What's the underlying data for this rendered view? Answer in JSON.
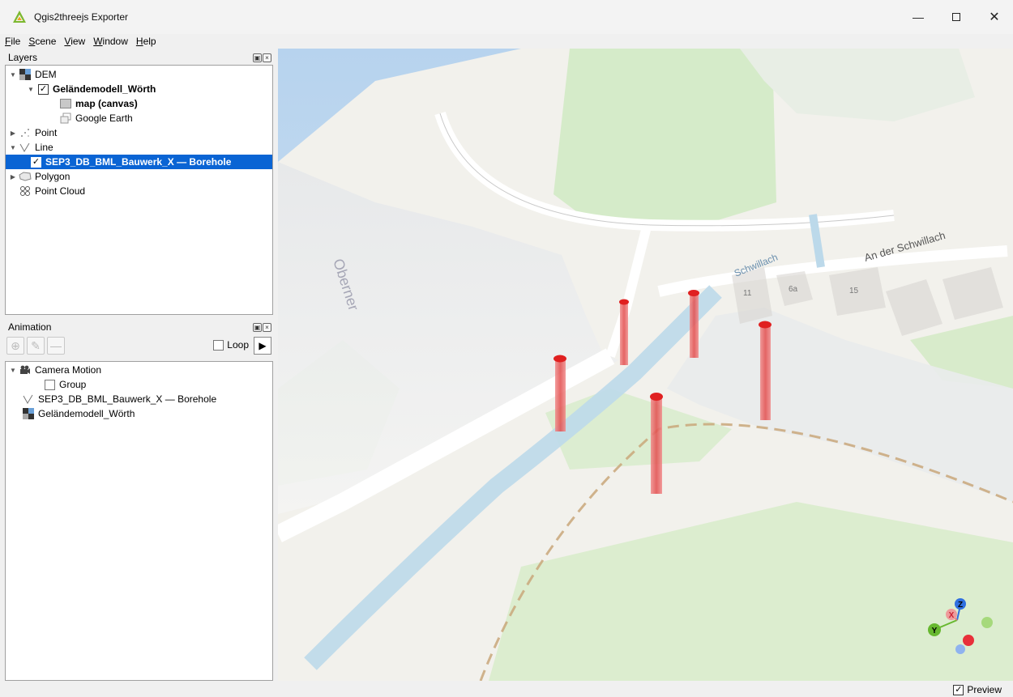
{
  "window": {
    "title": "Qgis2threejs Exporter"
  },
  "menu": [
    {
      "label": "File",
      "accel": "F",
      "rest": "ile"
    },
    {
      "label": "Scene",
      "accel": "S",
      "rest": "cene"
    },
    {
      "label": "View",
      "accel": "V",
      "rest": "iew"
    },
    {
      "label": "Window",
      "accel": "W",
      "rest": "indow"
    },
    {
      "label": "Help",
      "accel": "H",
      "rest": "elp"
    }
  ],
  "layers_panel": {
    "title": "Layers",
    "items": [
      {
        "label": "DEM"
      },
      {
        "label": "Geländemodell_Wörth"
      },
      {
        "label": "map (canvas)"
      },
      {
        "label": "Google Earth"
      },
      {
        "label": "Point"
      },
      {
        "label": "Line"
      },
      {
        "label": "SEP3_DB_BML_Bauwerk_X — Borehole"
      },
      {
        "label": "Polygon"
      },
      {
        "label": "Point Cloud"
      }
    ]
  },
  "animation_panel": {
    "title": "Animation",
    "loop_label": "Loop",
    "items": [
      {
        "label": "Camera Motion"
      },
      {
        "label": "Group"
      },
      {
        "label": "SEP3_DB_BML_Bauwerk_X — Borehole"
      },
      {
        "label": "Geländemodell_Wörth"
      }
    ]
  },
  "map_labels": {
    "street1": "An der Schwillach",
    "street2": "Oberner",
    "stream": "Schwillach",
    "house1": "11",
    "house2": "6a",
    "house3": "15"
  },
  "axes": {
    "x": "X",
    "y": "Y",
    "z": "Z"
  },
  "status": {
    "preview_label": "Preview"
  },
  "colors": {
    "selection": "#0a64d4",
    "borehole": "#e84a4a"
  }
}
